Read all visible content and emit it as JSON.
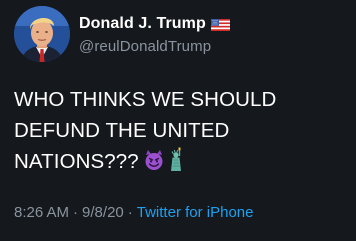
{
  "author": {
    "display_name": "Donald J. Trump",
    "handle": "@reulDonaldTrump",
    "avatar_icon": "profile-photo",
    "badge_icon": "us-flag-icon"
  },
  "tweet": {
    "text": "WHO THINKS WE SHOULD DEFUND THE UNITED NATIONS???",
    "emojis": [
      "smiling-devil-emoji",
      "statue-of-liberty-emoji"
    ]
  },
  "meta": {
    "time": "8:26 AM",
    "separator": "·",
    "date": "9/8/20",
    "source": "Twitter for iPhone"
  },
  "colors": {
    "background": "#15181c",
    "secondary_text": "#8a949e",
    "link": "#1da1f2"
  }
}
